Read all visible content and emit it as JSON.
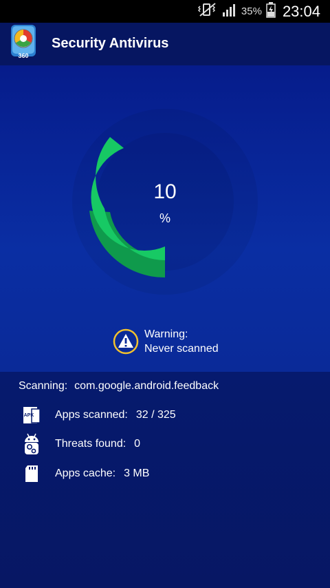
{
  "status_bar": {
    "battery_percent": "35%",
    "time": "23:04"
  },
  "app": {
    "title": "Security Antivirus",
    "logo_text": "360"
  },
  "progress": {
    "value": "10",
    "unit": "%",
    "fraction": 0.1
  },
  "warning": {
    "line1": "Warning:",
    "line2": "Never scanned"
  },
  "scanning": {
    "label": "Scanning:",
    "value": "com.google.android.feedback"
  },
  "stats": [
    {
      "icon": "apk-icon",
      "label": "Apps scanned:",
      "value": "32 / 325"
    },
    {
      "icon": "android-gear-icon",
      "label": "Threats found:",
      "value": "0"
    },
    {
      "icon": "sd-card-icon",
      "label": "Apps cache:",
      "value": "3 MB"
    }
  ],
  "colors": {
    "accent_green": "#17c964",
    "dark_green": "#0f9a4c",
    "warning_yellow": "#f2c12e",
    "background_blue": "#0a2ea3"
  }
}
